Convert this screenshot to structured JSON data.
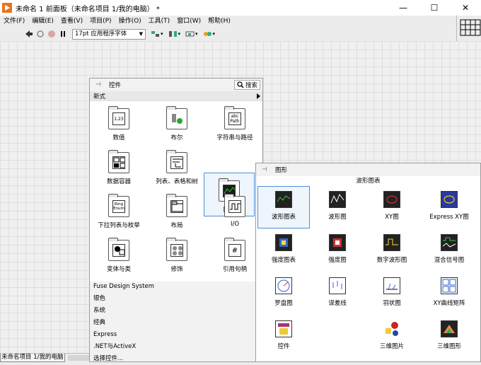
{
  "window": {
    "title": "未命名 1 前面板（未命名项目 1/我的电脑） *",
    "min": "—",
    "max": "☐",
    "close": "✕"
  },
  "menu": [
    "文件(F)",
    "编辑(E)",
    "查看(V)",
    "项目(P)",
    "操作(O)",
    "工具(T)",
    "窗口(W)",
    "帮助(H)"
  ],
  "toolbar": {
    "font": "17pt 应用程序字体"
  },
  "controls_palette": {
    "title": "控件",
    "search": "搜索",
    "category": "新式",
    "items": [
      "数值",
      "布尔",
      "字符串与路径",
      "数据容器",
      "列表、表格和树",
      "图形",
      "下拉列表与枚举",
      "布局",
      "I/O",
      "变体与类",
      "修饰",
      "引用句柄"
    ],
    "icon_texts": {
      "numeric": "1.23",
      "string": [
        "abc",
        "Path"
      ],
      "ring": [
        "Ring",
        "Enum"
      ]
    },
    "categories": [
      "Fuse Design System",
      "银色",
      "系统",
      "经典",
      "Express",
      ".NET与ActiveX",
      "选择控件..."
    ]
  },
  "graph_palette": {
    "title": "图形",
    "subtitle": "波形图表",
    "items": [
      "波形图表",
      "波形图",
      "XY图",
      "Express XY图",
      "强度图表",
      "强度图",
      "数字波形图",
      "混合信号图",
      "罗盘图",
      "误差线",
      "羽状图",
      "XY曲线矩阵",
      "控件",
      "三维图片",
      "三维图形"
    ]
  },
  "status": {
    "project": "未命名项目 1/我的电脑"
  }
}
